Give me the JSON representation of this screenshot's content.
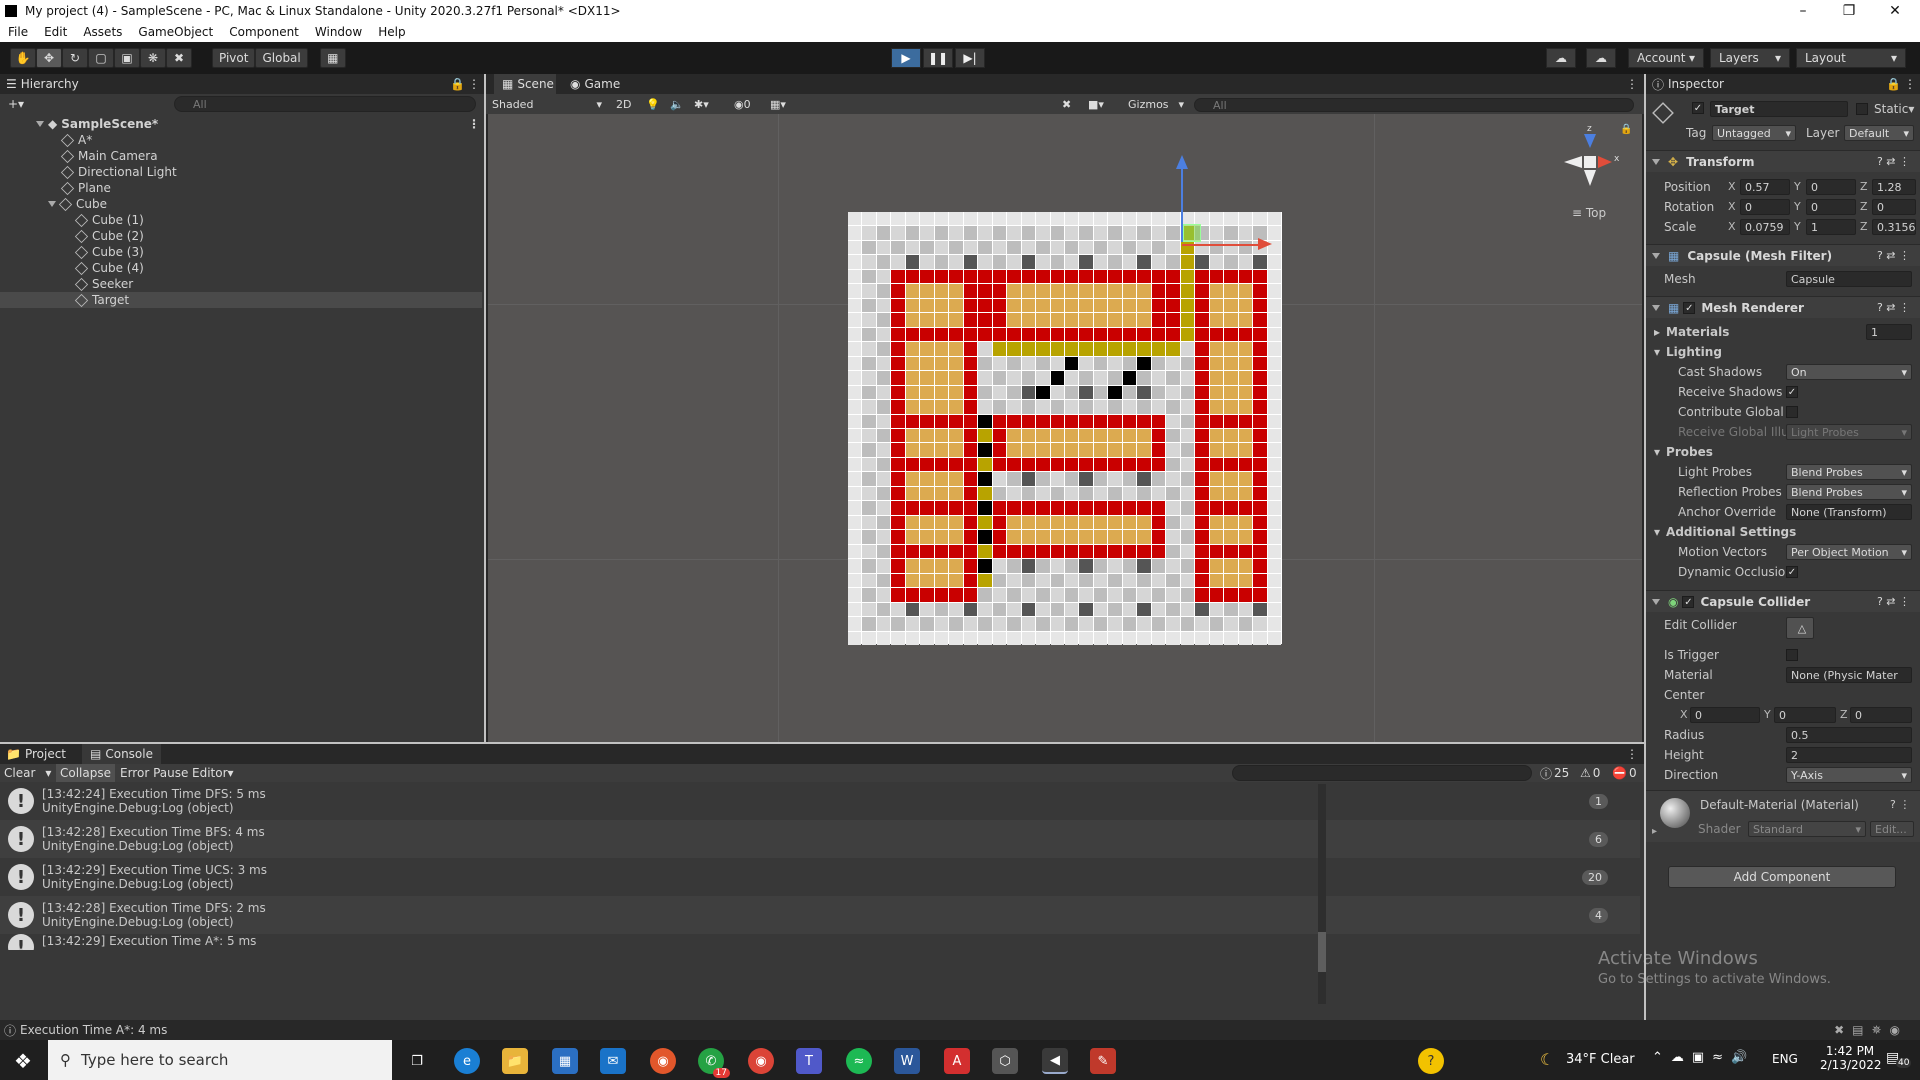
{
  "window": {
    "title": "My project (4) - SampleScene - PC, Mac & Linux Standalone - Unity 2020.3.27f1 Personal* <DX11>"
  },
  "menu": [
    "File",
    "Edit",
    "Assets",
    "GameObject",
    "Component",
    "Window",
    "Help"
  ],
  "toolbar": {
    "pivot": "Pivot",
    "global": "Global",
    "account": "Account",
    "layers": "Layers",
    "layout": "Layout"
  },
  "hierarchy": {
    "tab": "Hierarchy",
    "search_placeholder": "All",
    "items": [
      {
        "label": "SampleScene*"
      },
      {
        "label": "A*"
      },
      {
        "label": "Main Camera"
      },
      {
        "label": "Directional Light"
      },
      {
        "label": "Plane"
      },
      {
        "label": "Cube"
      },
      {
        "label": "Cube (1)"
      },
      {
        "label": "Cube (2)"
      },
      {
        "label": "Cube (3)"
      },
      {
        "label": "Cube (4)"
      },
      {
        "label": "Seeker"
      },
      {
        "label": "Target"
      }
    ]
  },
  "scene": {
    "tab_scene": "Scene",
    "tab_game": "Game",
    "shading": "Shaded",
    "mode_2d": "2D",
    "gizmos": "Gizmos",
    "hidden_count": "0",
    "search_placeholder": "All",
    "view_label": "Top",
    "axis_x": "x",
    "axis_z": "z"
  },
  "inspector": {
    "tab": "Inspector",
    "object_name": "Target",
    "static_label": "Static",
    "tag_label": "Tag",
    "tag_value": "Untagged",
    "layer_label": "Layer",
    "layer_value": "Default",
    "transform": {
      "title": "Transform",
      "position_label": "Position",
      "pos": [
        "0.57",
        "0",
        "1.28"
      ],
      "rotation_label": "Rotation",
      "rot": [
        "0",
        "0",
        "0"
      ],
      "scale_label": "Scale",
      "scale": [
        "0.0759",
        "1",
        "0.3156I"
      ]
    },
    "mesh_filter": {
      "title": "Capsule (Mesh Filter)",
      "mesh_label": "Mesh",
      "mesh_value": "Capsule"
    },
    "mesh_renderer": {
      "title": "Mesh Renderer",
      "materials_label": "Materials",
      "materials_count": "1",
      "lighting_label": "Lighting",
      "cast_shadows_label": "Cast Shadows",
      "cast_shadows_value": "On",
      "receive_shadows_label": "Receive Shadows",
      "contribute_gi_label": "Contribute Global I",
      "receive_gi_label": "Receive Global Illu",
      "receive_gi_value": "Light Probes",
      "probes_label": "Probes",
      "light_probes_label": "Light Probes",
      "light_probes_value": "Blend Probes",
      "refl_probes_label": "Reflection Probes",
      "refl_probes_value": "Blend Probes",
      "anchor_label": "Anchor Override",
      "anchor_value": "None (Transform)",
      "additional_label": "Additional Settings",
      "motion_label": "Motion Vectors",
      "motion_value": "Per Object Motion",
      "dynamic_label": "Dynamic Occlusio"
    },
    "capsule_collider": {
      "title": "Capsule Collider",
      "edit_label": "Edit Collider",
      "trigger_label": "Is Trigger",
      "material_label": "Material",
      "material_value": "None (Physic Mater",
      "center_label": "Center",
      "center": [
        "0",
        "0",
        "0"
      ],
      "radius_label": "Radius",
      "radius": "0.5",
      "height_label": "Height",
      "height": "2",
      "direction_label": "Direction",
      "direction": "Y-Axis"
    },
    "material": {
      "name": "Default-Material (Material)",
      "shader_label": "Shader",
      "shader_value": "Standard",
      "edit_label": "Edit..."
    },
    "add_component": "Add Component"
  },
  "console": {
    "tab_project": "Project",
    "tab_console": "Console",
    "clear": "Clear",
    "collapse": "Collapse",
    "error_pause": "Error Pause",
    "editor": "Editor",
    "count_log": "25",
    "count_warn": "0",
    "count_err": "0",
    "entries": [
      {
        "line1": "[13:42:24] Execution Time DFS: 5 ms",
        "line2": "UnityEngine.Debug:Log (object)",
        "count": "1"
      },
      {
        "line1": "[13:42:28] Execution Time BFS: 4 ms",
        "line2": "UnityEngine.Debug:Log (object)",
        "count": "6"
      },
      {
        "line1": "[13:42:29] Execution Time UCS: 3 ms",
        "line2": "UnityEngine.Debug:Log (object)",
        "count": "20"
      },
      {
        "line1": "[13:42:28] Execution Time DFS: 2 ms",
        "line2": "UnityEngine.Debug:Log (object)",
        "count": "4"
      },
      {
        "line1": "[13:42:29] Execution Time A*: 5 ms",
        "line2": "",
        "count": ""
      }
    ]
  },
  "status": {
    "text": "Execution Time A*: 4 ms"
  },
  "watermark": {
    "line1": "Activate Windows",
    "line2": "Go to Settings to activate Windows."
  },
  "taskbar": {
    "search_placeholder": "Type here to search",
    "weather": "34°F  Clear",
    "lang": "ENG",
    "time": "1:42 PM",
    "date": "2/13/2022",
    "whatsapp_badge": "17",
    "notif_badge": "40"
  },
  "colors": {
    "accent": "#3c6c9e",
    "wall": "#c90000",
    "floor": "#dcaa50",
    "path": "#b8a300",
    "visited": "#000000"
  }
}
